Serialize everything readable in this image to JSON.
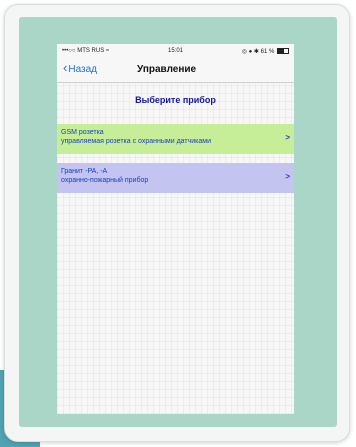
{
  "status_bar": {
    "carrier": "•••○○ MTS RUS",
    "wifi_icon": "wifi-icon",
    "time": "15:01",
    "indicators": "◎ ● ✱",
    "battery_percent": "61 %",
    "battery_level": 0.61
  },
  "nav": {
    "back_label": "Назад",
    "title": "Управление"
  },
  "heading": "Выберите прибор",
  "devices": [
    {
      "title": "GSM розетка",
      "subtitle": "управляемая розетка с охранными датчиками",
      "arrow": ">"
    },
    {
      "title": "Гранит -РА, -А",
      "subtitle": "охранно-пожарный прибор",
      "arrow": ">"
    }
  ],
  "colors": {
    "frame": "#a9d6c7",
    "item_green": "#c6ee99",
    "item_purple": "#c3c4f0",
    "link_blue": "#1a73e8",
    "heading_blue": "#1515a8"
  }
}
